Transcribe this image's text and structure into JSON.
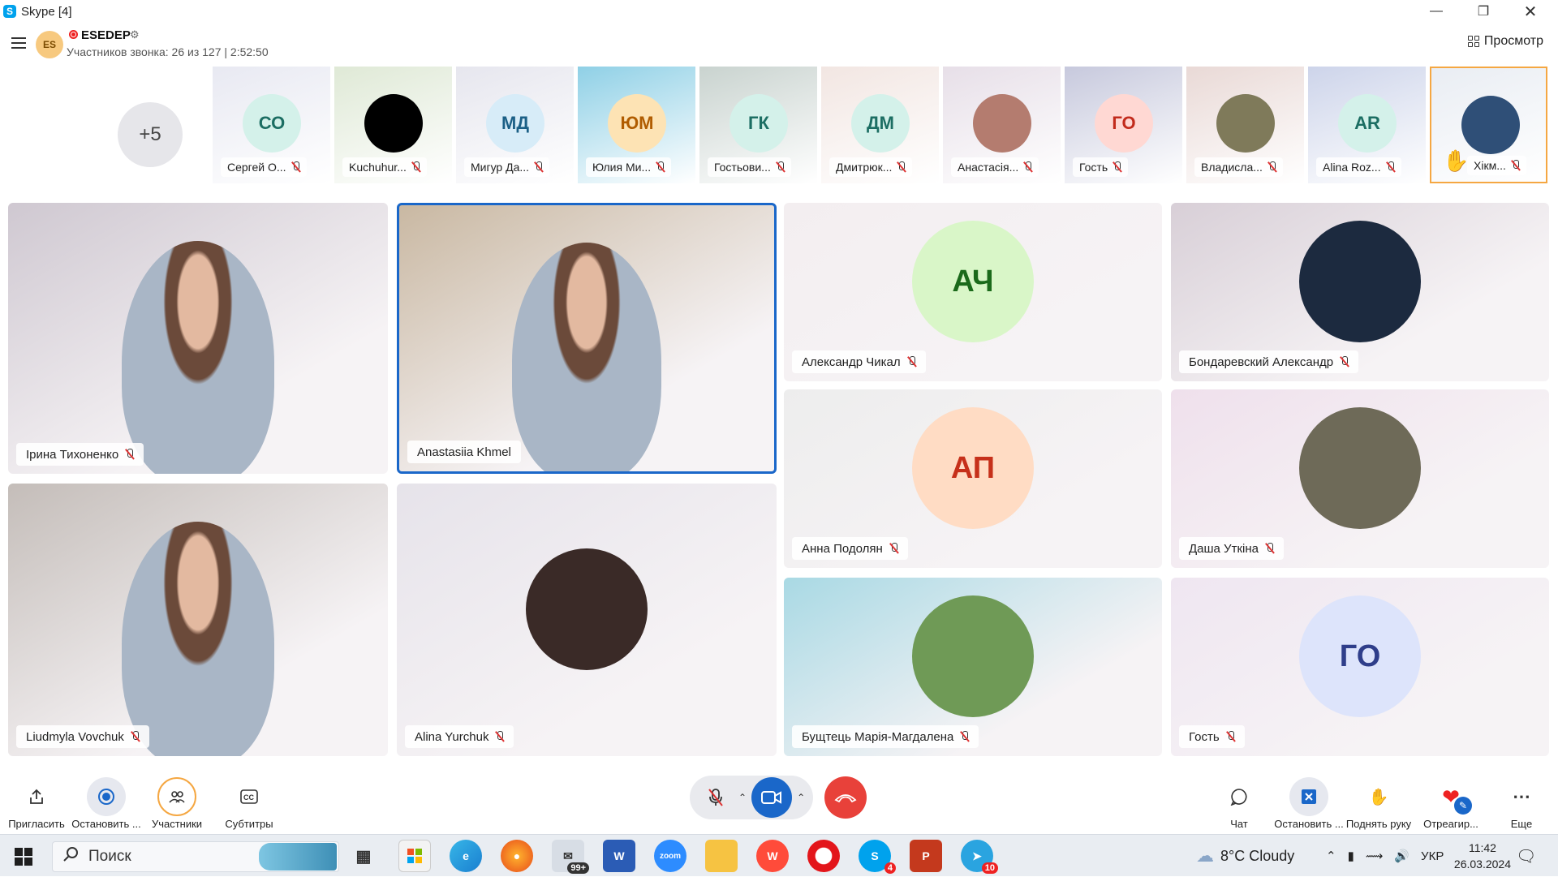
{
  "window": {
    "title": "Skype [4]",
    "app_icon": "S"
  },
  "header": {
    "group_initials": "ES",
    "group_name": "ESEDEP",
    "call_info": "Участников звонка: 26 из 127 | 2:52:50",
    "view_label": "Просмотр"
  },
  "strip": {
    "more_label": "+5",
    "thumbs": [
      {
        "initials": "СО",
        "name": "Сергей О...",
        "bg": "#e8e9f2",
        "ava_bg": "#d4f1ea",
        "ava_fg": "#1c6e63"
      },
      {
        "initials": "",
        "name": "Kuchuhur...",
        "bg": "#dfe9d6",
        "ava_bg": "#000000",
        "ava_fg": "#000000"
      },
      {
        "initials": "МД",
        "name": "Мигур Да...",
        "bg": "#e6e6ee",
        "ava_bg": "#d7ecf8",
        "ava_fg": "#1b5f86"
      },
      {
        "initials": "ЮМ",
        "name": "Юлия Ми...",
        "bg": "#8fd0e6",
        "ava_bg": "#fde3b4",
        "ava_fg": "#b05c00"
      },
      {
        "initials": "ГК",
        "name": "Гостьови...",
        "bg": "#c9d3cf",
        "ava_bg": "#d4f1ea",
        "ava_fg": "#1c6e63"
      },
      {
        "initials": "ДМ",
        "name": "Дмитрюк...",
        "bg": "#f2e6e2",
        "ava_bg": "#d4f1ea",
        "ava_fg": "#1c6e63"
      },
      {
        "initials": "",
        "name": "Анастасія...",
        "bg": "#e7dfe8",
        "ava_bg": "#b47c6f",
        "ava_fg": "#ffffff"
      },
      {
        "initials": "ГО",
        "name": "Гость",
        "bg": "#c7c9dd",
        "ava_bg": "#ffd8d3",
        "ava_fg": "#c22b1c"
      },
      {
        "initials": "",
        "name": "Владисла...",
        "bg": "#e9d9d6",
        "ava_bg": "#7f7a5a",
        "ava_fg": "#ffffff"
      },
      {
        "initials": "AR",
        "name": "Alina Roz...",
        "bg": "#cdd4ea",
        "ava_bg": "#d4f1ea",
        "ava_fg": "#1c6e63"
      },
      {
        "initials": "",
        "name": "Хікм...",
        "bg": "#e9edf3",
        "ava_bg": "#2f4f77",
        "ava_fg": "#ffffff",
        "hand_raised": true
      }
    ]
  },
  "tiles": [
    {
      "name": "Ірина Тихоненко",
      "kind": "video",
      "bg": "#cfc8d1"
    },
    {
      "name": "Anastasiia Khmel",
      "kind": "video",
      "bg": "#c9b8a2",
      "active": true
    },
    {
      "name": "Александр Чикал",
      "kind": "avatar",
      "initials": "АЧ",
      "bg": "#f3eef0",
      "ava_bg": "#d9f6c8",
      "ava_fg": "#1b6a1b"
    },
    {
      "name": "Бондаревский Александр",
      "kind": "photo",
      "bg": "#d8cfd7",
      "ava_bg": "#1c2a3f"
    },
    {
      "name": "Liudmyla Vovchuk",
      "kind": "video",
      "bg": "#c4bdb9"
    },
    {
      "name": "Alina Yurchuk",
      "kind": "photo",
      "bg": "#e6e3ea",
      "ava_bg": "#3a2a27"
    },
    {
      "name": "Анна Подолян",
      "kind": "avatar",
      "initials": "АП",
      "bg": "#ededed",
      "ava_bg": "#ffdcc4",
      "ava_fg": "#c6301a"
    },
    {
      "name": "Даша Уткіна",
      "kind": "photo",
      "bg": "#efe0ec",
      "ava_bg": "#6e6a58"
    },
    {
      "name": "Бущтець Марія-Магдалена",
      "kind": "photo",
      "bg": "#a9d9e4",
      "ava_bg": "#6f9a56"
    },
    {
      "name": "Гость",
      "kind": "avatar",
      "initials": "ГО",
      "bg": "#efe6f1",
      "ava_bg": "#dde4fb",
      "ava_fg": "#2f3e8a"
    }
  ],
  "toolbar": {
    "invite_label": "Пригласить",
    "stop_label": "Остановить ...",
    "participants_label": "Участники",
    "subtitles_label": "Субтитры",
    "chat_label": "Чат",
    "stop_share_label": "Остановить ...",
    "raise_hand_label": "Поднять руку",
    "react_label": "Отреагир...",
    "more_label": "Еще"
  },
  "taskbar": {
    "search_placeholder": "Поиск",
    "mail_badge": "99+",
    "skype_badge": "4",
    "telegram_badge": "10",
    "word_letter": "W",
    "ppt_letter": "P",
    "zoom_label": "zoom",
    "weather": "8°C  Cloudy",
    "lang": "УКР",
    "time": "11:42",
    "date": "26.03.2024"
  },
  "colors": {
    "accent": "#0078d4",
    "end_call": "#e8413a",
    "active_border": "#1a67c9",
    "hand_border": "#f5a742"
  }
}
